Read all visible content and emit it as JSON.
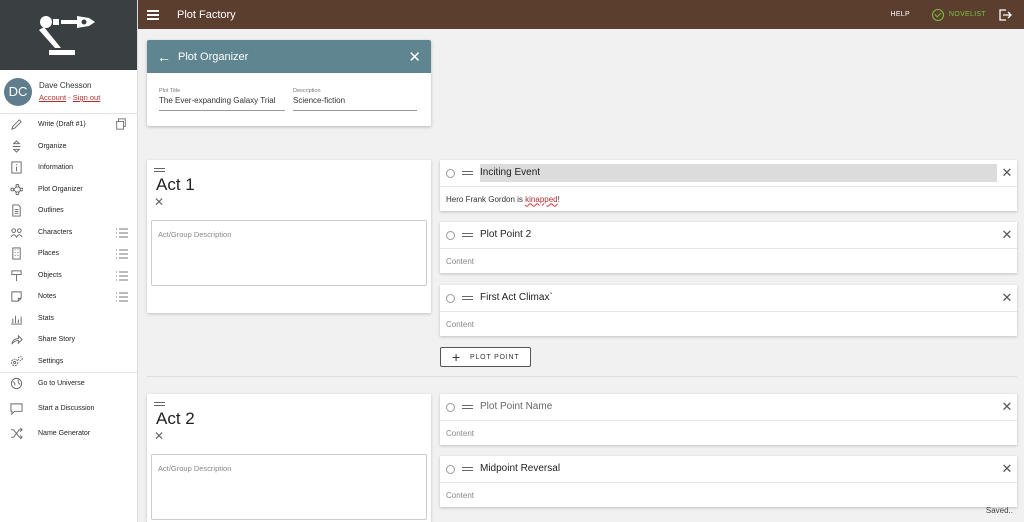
{
  "app": {
    "title": "Plot Factory"
  },
  "topbar": {
    "help": "HELP",
    "status": "NOVELIST"
  },
  "user": {
    "initials": "DC",
    "name": "Dave Chesson",
    "account": "Account",
    "separator": " - ",
    "signout": "Sign out"
  },
  "sidebar": {
    "items": [
      {
        "label": "Write (Draft #1)",
        "icon": "pencil-icon",
        "extra": "copy-icon"
      },
      {
        "label": "Organize",
        "icon": "sort-icon"
      },
      {
        "label": "Information",
        "icon": "info-icon"
      },
      {
        "label": "Plot Organizer",
        "icon": "nodes-icon"
      },
      {
        "label": "Outlines",
        "icon": "document-icon"
      },
      {
        "label": "Characters",
        "icon": "people-icon",
        "extra": "list-icon"
      },
      {
        "label": "Places",
        "icon": "building-icon",
        "extra": "list-icon"
      },
      {
        "label": "Objects",
        "icon": "signpost-icon",
        "extra": "list-icon"
      },
      {
        "label": "Notes",
        "icon": "note-icon",
        "extra": "list-icon"
      },
      {
        "label": "Stats",
        "icon": "bar-chart-icon"
      },
      {
        "label": "Share Story",
        "icon": "share-icon"
      },
      {
        "label": "Settings",
        "icon": "gears-icon"
      },
      {
        "label": "Go to Universe",
        "icon": "globe-icon"
      },
      {
        "label": "Start a Discussion",
        "icon": "chat-icon"
      },
      {
        "label": "Name Generator",
        "icon": "shuffle-icon"
      }
    ]
  },
  "organizer": {
    "title": "Plot Organizer",
    "plot_title_label": "Plot Title",
    "plot_title_value": "The Ever-expanding Galaxy Trial",
    "description_label": "Description",
    "description_value": "Science-fiction"
  },
  "acts": [
    {
      "title": "Act 1",
      "desc_placeholder": "Act/Group Description"
    },
    {
      "title": "Act 2",
      "desc_placeholder": "Act/Group Description"
    }
  ],
  "plot_points": [
    {
      "title": "Inciting Event",
      "content_pre": "Hero Frank Gordon is ",
      "content_err": "kinapped",
      "content_post": "!"
    },
    {
      "title": "Plot Point 2",
      "content": "Content"
    },
    {
      "title": "First Act Climax`",
      "content": "Content"
    },
    {
      "title": "Plot Point Name",
      "content": "Content"
    },
    {
      "title": "Midpoint Reversal",
      "content": "Content"
    }
  ],
  "add_plot_point": "PLOT POINT",
  "saved": "Saved..",
  "colors": {
    "topbar": "#5b3e2d",
    "sidebar_header": "#3a3f42",
    "card_header": "#5f8591",
    "accent_green": "#7bc043"
  }
}
